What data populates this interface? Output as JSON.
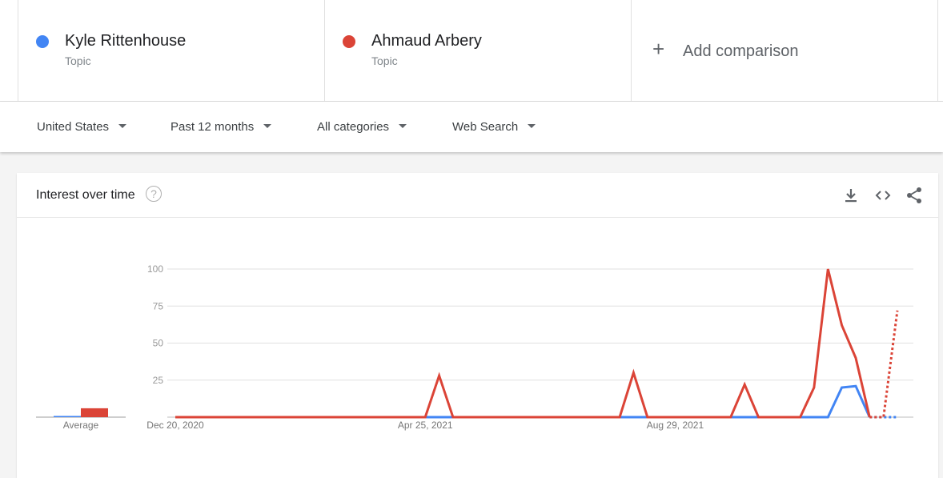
{
  "comparison": {
    "terms": [
      {
        "name": "Kyle Rittenhouse",
        "kind": "Topic",
        "color": "#4285f4"
      },
      {
        "name": "Ahmaud Arbery",
        "kind": "Topic",
        "color": "#db4437"
      }
    ],
    "add_label": "Add comparison",
    "add_icon": "plus-icon"
  },
  "filters": {
    "region": "United States",
    "time": "Past 12 months",
    "category": "All categories",
    "search_type": "Web Search"
  },
  "card": {
    "title": "Interest over time",
    "icons": [
      "help-icon",
      "download-icon",
      "embed-icon",
      "share-icon"
    ]
  },
  "chart_data": {
    "type": "line",
    "title": "Interest over time",
    "ylim": [
      0,
      100
    ],
    "yticks": [
      25,
      50,
      75,
      100
    ],
    "grid": true,
    "x_tick_labels": [
      "Dec 20, 2020",
      "Apr 25, 2021",
      "Aug 29, 2021"
    ],
    "x_tick_index": [
      0,
      18,
      36
    ],
    "average_label": "Average",
    "averages": [
      0,
      6
    ],
    "partial_from_index": 50,
    "series": [
      {
        "name": "Kyle Rittenhouse",
        "color": "#4285f4",
        "values": [
          0,
          0,
          0,
          0,
          0,
          0,
          0,
          0,
          0,
          0,
          0,
          0,
          0,
          0,
          0,
          0,
          0,
          0,
          0,
          0,
          0,
          0,
          0,
          0,
          0,
          0,
          0,
          0,
          0,
          0,
          0,
          0,
          0,
          0,
          0,
          0,
          0,
          0,
          0,
          0,
          0,
          0,
          0,
          0,
          0,
          0,
          0,
          0,
          20,
          21,
          0,
          0,
          0
        ]
      },
      {
        "name": "Ahmaud Arbery",
        "color": "#db4437",
        "values": [
          0,
          0,
          0,
          0,
          0,
          0,
          0,
          0,
          0,
          0,
          0,
          0,
          0,
          0,
          0,
          0,
          0,
          0,
          0,
          28,
          0,
          0,
          0,
          0,
          0,
          0,
          0,
          0,
          0,
          0,
          0,
          0,
          0,
          30,
          0,
          0,
          0,
          0,
          0,
          0,
          0,
          22,
          0,
          0,
          0,
          0,
          20,
          100,
          62,
          40,
          0,
          0,
          72
        ]
      }
    ]
  }
}
